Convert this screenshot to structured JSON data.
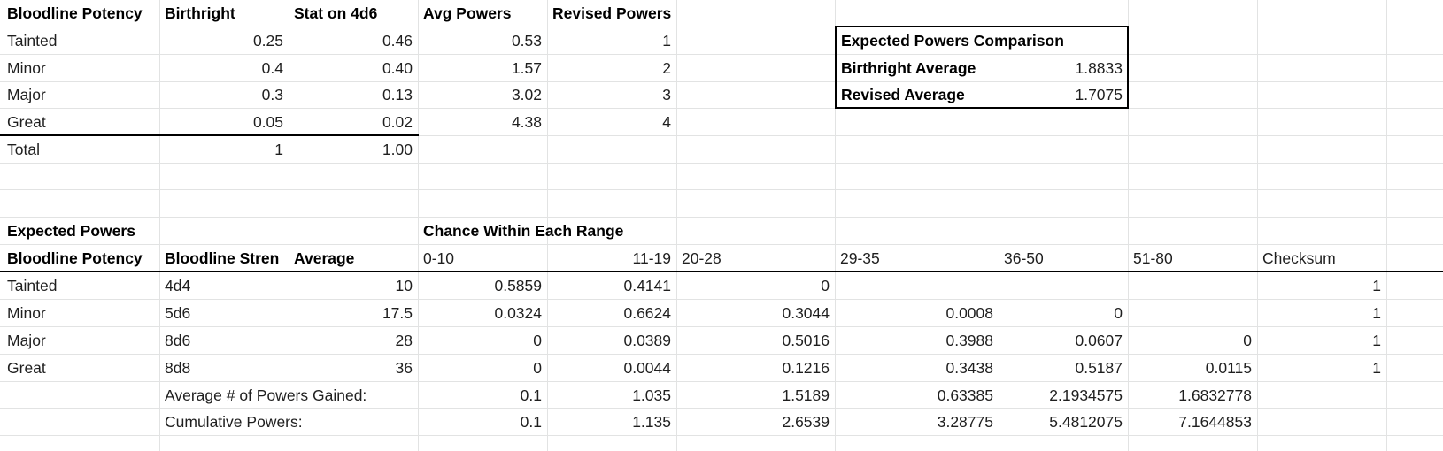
{
  "top_table": {
    "headers": [
      "Bloodline Potency",
      "Birthright",
      "Stat on 4d6",
      "Avg Powers",
      "Revised Powers"
    ],
    "rows": [
      [
        "Tainted",
        "0.25",
        "0.46",
        "0.53",
        "1"
      ],
      [
        "Minor",
        "0.4",
        "0.40",
        "1.57",
        "2"
      ],
      [
        "Major",
        "0.3",
        "0.13",
        "3.02",
        "3"
      ],
      [
        "Great",
        "0.05",
        "0.02",
        "4.38",
        "4"
      ]
    ],
    "total_row": [
      "Total",
      "1",
      "1.00"
    ]
  },
  "comparison": {
    "title": "Expected Powers Comparison",
    "rows": [
      [
        "Birthright Average",
        "1.8833"
      ],
      [
        "Revised Average",
        "1.7075"
      ]
    ]
  },
  "expected": {
    "title": "Expected Powers",
    "chance_title": "Chance Within Each Range",
    "headers": [
      "Bloodline Potency",
      "Bloodline Stren",
      "Average",
      "0-10",
      "11-19",
      "20-28",
      "29-35",
      "36-50",
      "51-80",
      "Checksum"
    ],
    "rows": [
      [
        "Tainted",
        "4d4",
        "10",
        "0.5859",
        "0.4141",
        "0",
        "",
        "",
        "",
        "1"
      ],
      [
        "Minor",
        "5d6",
        "17.5",
        "0.0324",
        "0.6624",
        "0.3044",
        "0.0008",
        "0",
        "",
        "1"
      ],
      [
        "Major",
        "8d6",
        "28",
        "0",
        "0.0389",
        "0.5016",
        "0.3988",
        "0.0607",
        "0",
        "1"
      ],
      [
        "Great",
        "8d8",
        "36",
        "0",
        "0.0044",
        "0.1216",
        "0.3438",
        "0.5187",
        "0.0115",
        "1"
      ]
    ],
    "avg_label": "Average # of Powers Gained:",
    "avg_values": [
      "0.1",
      "1.035",
      "1.5189",
      "0.63385",
      "2.1934575",
      "1.6832778"
    ],
    "cum_label": "Cumulative Powers:",
    "cum_values": [
      "0.1",
      "1.135",
      "2.6539",
      "3.28775",
      "5.4812075",
      "7.1644853"
    ]
  }
}
